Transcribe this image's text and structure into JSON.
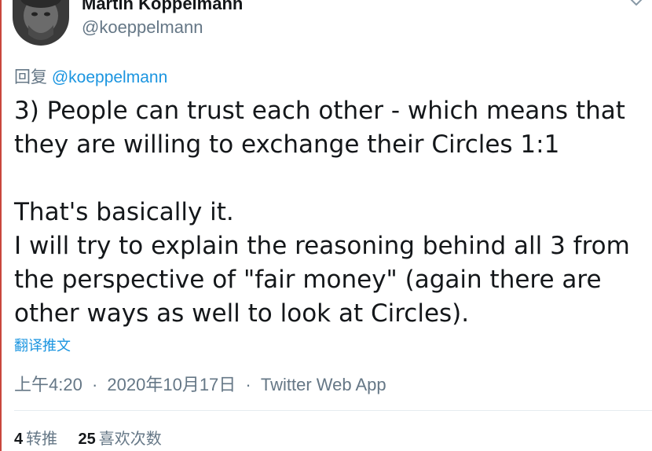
{
  "author": {
    "display_name": "Martin Köppelmann",
    "handle": "@koeppelmann"
  },
  "reply": {
    "prefix": "回复",
    "to_handle": "@koeppelmann"
  },
  "tweet": {
    "lines": [
      "3) People can trust each other - which means that",
      "they are willing to exchange their Circles 1:1",
      "",
      "That's basically it.",
      "I will try to explain the reasoning behind all 3 from",
      "the perspective of \"fair money\" (again there are",
      "other ways as well to look at Circles)."
    ]
  },
  "translate_label": "翻译推文",
  "meta": {
    "time": "上午4:20",
    "separator": "·",
    "date": "2020年10月17日",
    "source": "Twitter Web App"
  },
  "stats": {
    "retweets_count": "4",
    "retweets_label": "转推",
    "likes_count": "25",
    "likes_label": "喜欢次数"
  },
  "icons": {
    "menu": "chevron-down-icon"
  },
  "colors": {
    "link": "#1b95e0",
    "secondary_text": "#657786",
    "primary_text": "#14171a",
    "left_rule": "#c9463d"
  }
}
